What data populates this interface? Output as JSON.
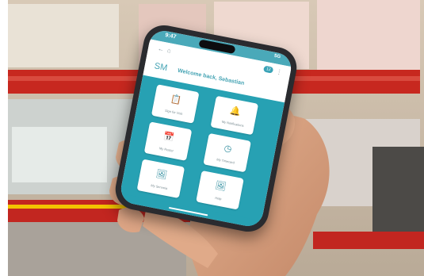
{
  "status": {
    "time": "9:47",
    "network": "5G"
  },
  "header": {
    "notification_count": "12"
  },
  "welcome": {
    "initials": "SM",
    "text": "Welcome back, Sebastian"
  },
  "tiles": [
    {
      "label": "Sign for Visit",
      "icon": "clipboard-icon"
    },
    {
      "label": "My Notifications",
      "icon": "bell-icon"
    },
    {
      "label": "My Roster",
      "icon": "calendar-icon"
    },
    {
      "label": "My Timecard",
      "icon": "clock-icon"
    },
    {
      "label": "My Servaria",
      "icon": "image-icon"
    },
    {
      "label": "Help",
      "icon": "image-icon"
    }
  ],
  "colors": {
    "accent": "#27a1b3",
    "brand_text": "#46a4b4"
  }
}
